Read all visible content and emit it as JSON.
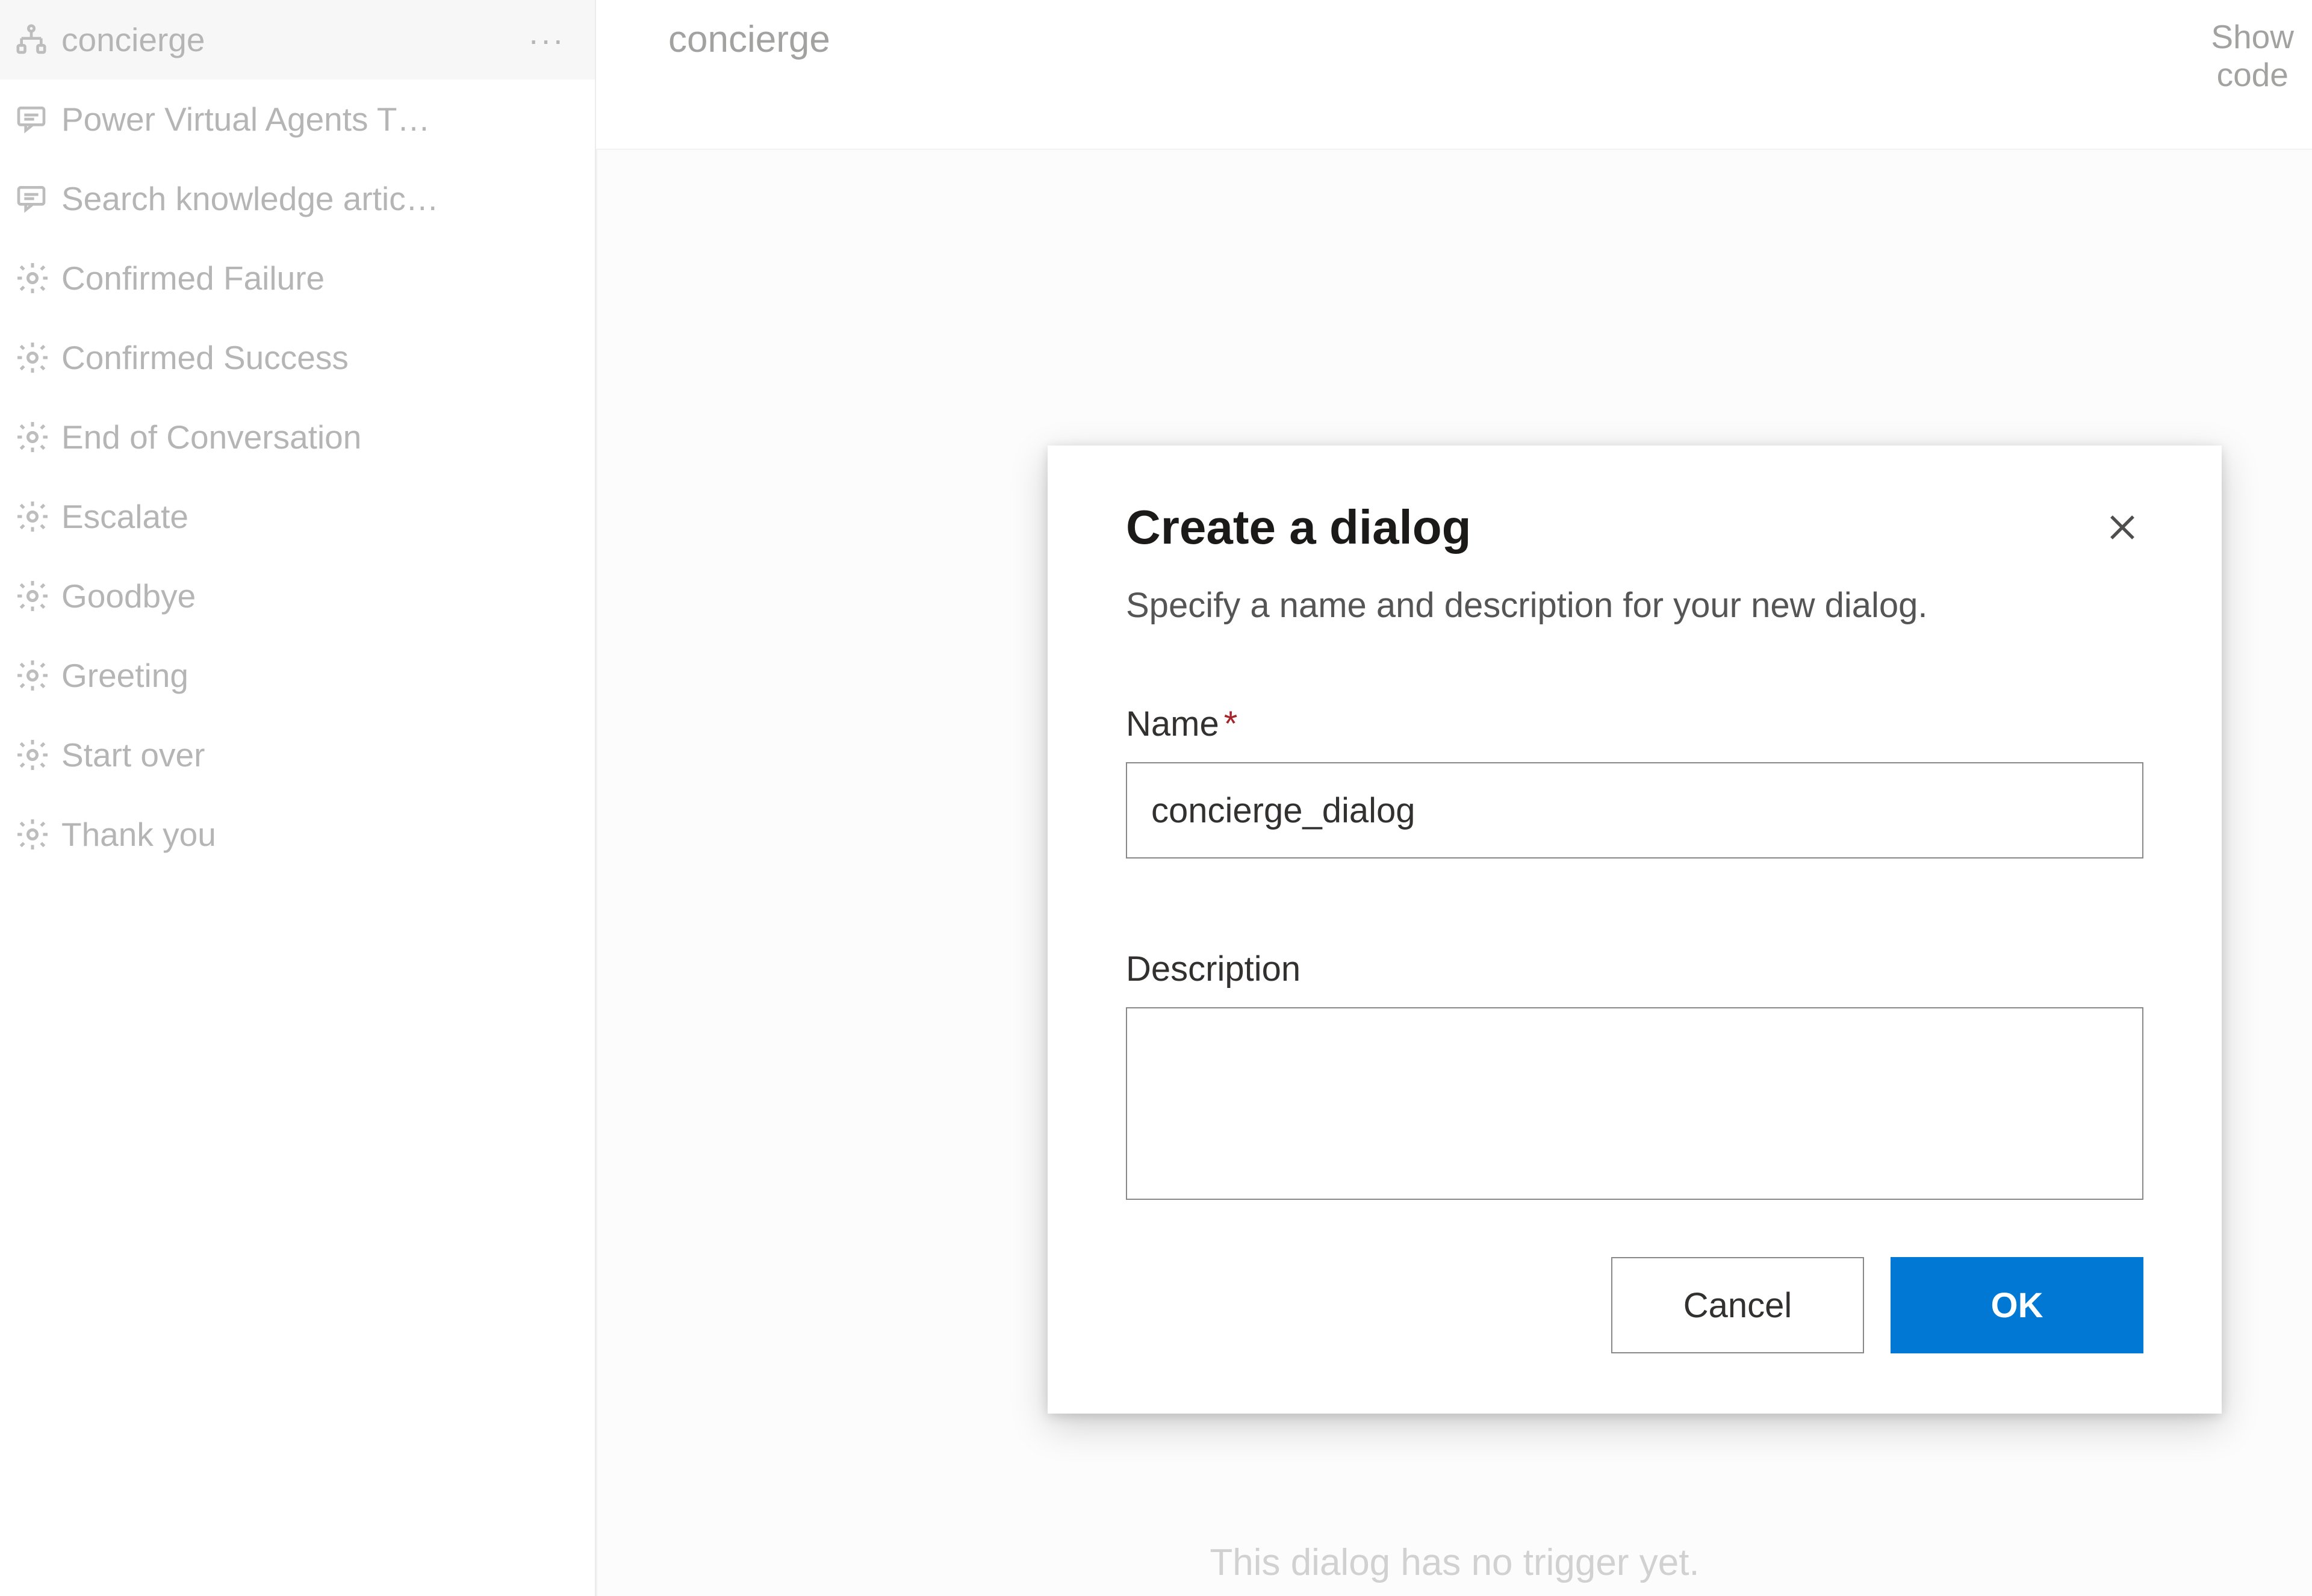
{
  "sidebar": {
    "items": [
      {
        "label": "concierge",
        "icon": "flow",
        "selected": true,
        "hasMenu": true
      },
      {
        "label": "Power Virtual Agents T…",
        "icon": "chat",
        "selected": false
      },
      {
        "label": "Search knowledge artic…",
        "icon": "chat",
        "selected": false
      },
      {
        "label": "Confirmed Failure",
        "icon": "gear",
        "selected": false
      },
      {
        "label": "Confirmed Success",
        "icon": "gear",
        "selected": false
      },
      {
        "label": "End of Conversation",
        "icon": "gear",
        "selected": false
      },
      {
        "label": "Escalate",
        "icon": "gear",
        "selected": false
      },
      {
        "label": "Goodbye",
        "icon": "gear",
        "selected": false
      },
      {
        "label": "Greeting",
        "icon": "gear",
        "selected": false
      },
      {
        "label": "Start over",
        "icon": "gear",
        "selected": false
      },
      {
        "label": "Thank you",
        "icon": "gear",
        "selected": false
      }
    ]
  },
  "header": {
    "title": "concierge",
    "showCodeLine1": "Show",
    "showCodeLine2": "code"
  },
  "canvas": {
    "noTrigger": "This dialog has no trigger yet."
  },
  "modal": {
    "title": "Create a dialog",
    "subtitle": "Specify a name and description for your new dialog.",
    "nameLabel": "Name",
    "nameValue": "concierge_dialog",
    "descriptionLabel": "Description",
    "descriptionValue": "",
    "cancelLabel": "Cancel",
    "okLabel": "OK"
  }
}
